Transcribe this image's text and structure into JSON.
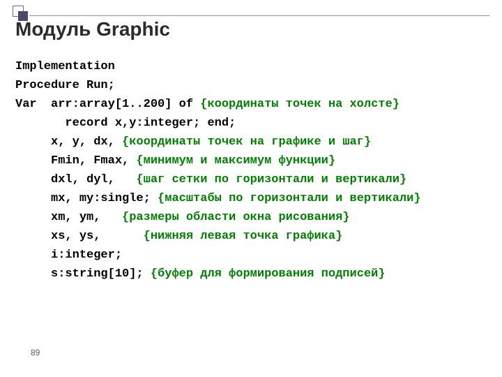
{
  "title": "Модуль Graphic",
  "page_number": "89",
  "code": {
    "l1": "Implementation",
    "l2": "Procedure Run;",
    "l3a": "Var  arr:array[1..200] of ",
    "l3c": "{координаты точек на холсте}",
    "l4": "       record x,y:integer; end;",
    "l5a": "     x, y, dx, ",
    "l5c": "{координаты точек на графике и шаг}",
    "l6a": "     Fmin, Fmax, ",
    "l6c": "{минимум и максимум функции}",
    "l7a": "     dxl, dyl,   ",
    "l7c": "{шаг сетки по горизонтали и вертикали}",
    "l8a": "     mx, my:single; ",
    "l8c": "{масштабы по горизонтали и вертикали}",
    "l9a": "     xm, ym,   ",
    "l9c": "{размеры области окна рисования}",
    "l10a": "     xs, ys,      ",
    "l10c": "{нижняя левая точка графика}",
    "l11": "     i:integer;",
    "l12a": "     s:string[10]; ",
    "l12c": "{буфер для формирования подписей}"
  }
}
